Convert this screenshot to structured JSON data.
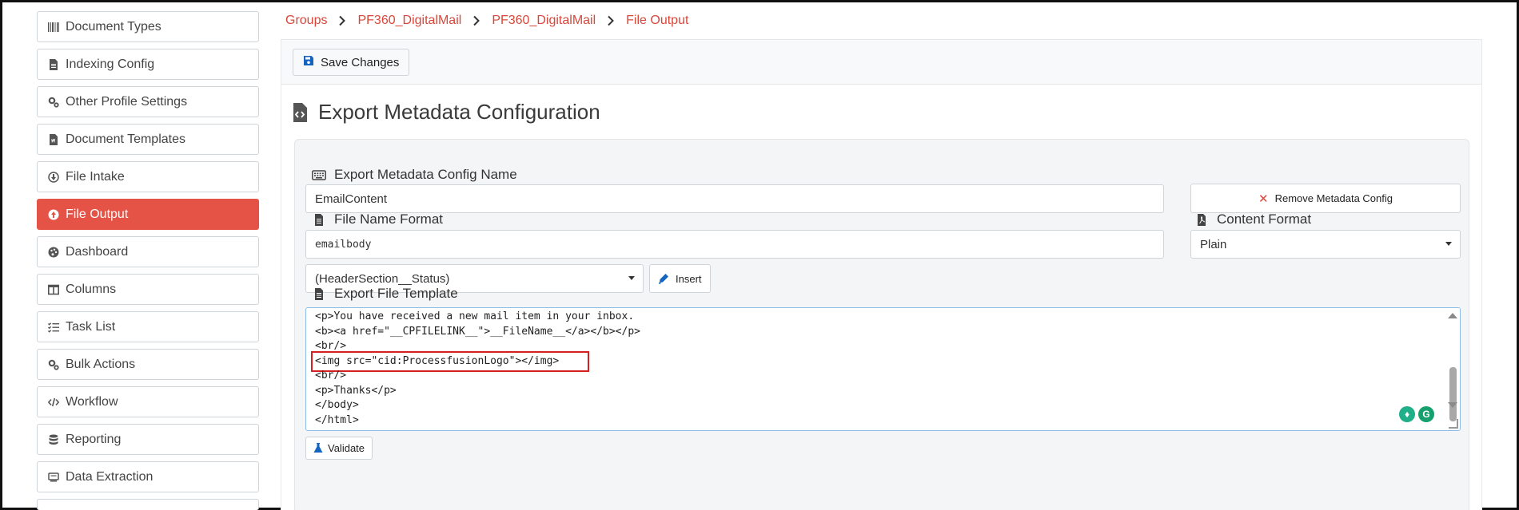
{
  "sidebar": {
    "items": [
      {
        "label": "Document Types",
        "icon": "barcode-icon",
        "active": false
      },
      {
        "label": "Indexing Config",
        "icon": "file-icon",
        "active": false
      },
      {
        "label": "Other Profile Settings",
        "icon": "cogs-icon",
        "active": false
      },
      {
        "label": "Document Templates",
        "icon": "file-word-icon",
        "active": false
      },
      {
        "label": "File Intake",
        "icon": "arrow-circle-down-icon",
        "active": false
      },
      {
        "label": "File Output",
        "icon": "arrow-circle-up-icon",
        "active": true
      },
      {
        "label": "Dashboard",
        "icon": "palette-icon",
        "active": false
      },
      {
        "label": "Columns",
        "icon": "columns-icon",
        "active": false
      },
      {
        "label": "Task List",
        "icon": "tasks-icon",
        "active": false
      },
      {
        "label": "Bulk Actions",
        "icon": "cogs-icon",
        "active": false
      },
      {
        "label": "Workflow",
        "icon": "code-icon",
        "active": false
      },
      {
        "label": "Reporting",
        "icon": "database-icon",
        "active": false
      },
      {
        "label": "Data Extraction",
        "icon": "receipt-icon",
        "active": false
      }
    ],
    "active_color": "#e55347"
  },
  "breadcrumb": [
    "Groups",
    "PF360_DigitalMail",
    "PF360_DigitalMail",
    "File Output"
  ],
  "toolbar": {
    "save_label": "Save Changes"
  },
  "page": {
    "title": "Export Metadata Configuration"
  },
  "form": {
    "config_name_label": "Export Metadata Config Name",
    "config_name_value": "EmailContent",
    "remove_label": "Remove Metadata Config",
    "file_name_format_label": "File Name Format",
    "file_name_format_value": "emailbody",
    "content_format_label": "Content Format",
    "content_format_value": "Plain",
    "field_select_value": "(HeaderSection__Status)",
    "insert_label": "Insert",
    "template_label": "Export File Template",
    "template_lines": [
      "<p>You have received a new mail item in your inbox.",
      "<b><a href=\"__CPFILELINK__\">__FileName__</a></b></p>",
      "<br/>",
      "<img src=\"cid:ProcessfusionLogo\"></img>",
      "<br/>",
      "<p>Thanks</p>",
      "</body>",
      "</html>"
    ],
    "validate_label": "Validate"
  },
  "colors": {
    "accent": "#d9473a",
    "highlight": "#d42020",
    "editor_border": "#8dbde6"
  }
}
